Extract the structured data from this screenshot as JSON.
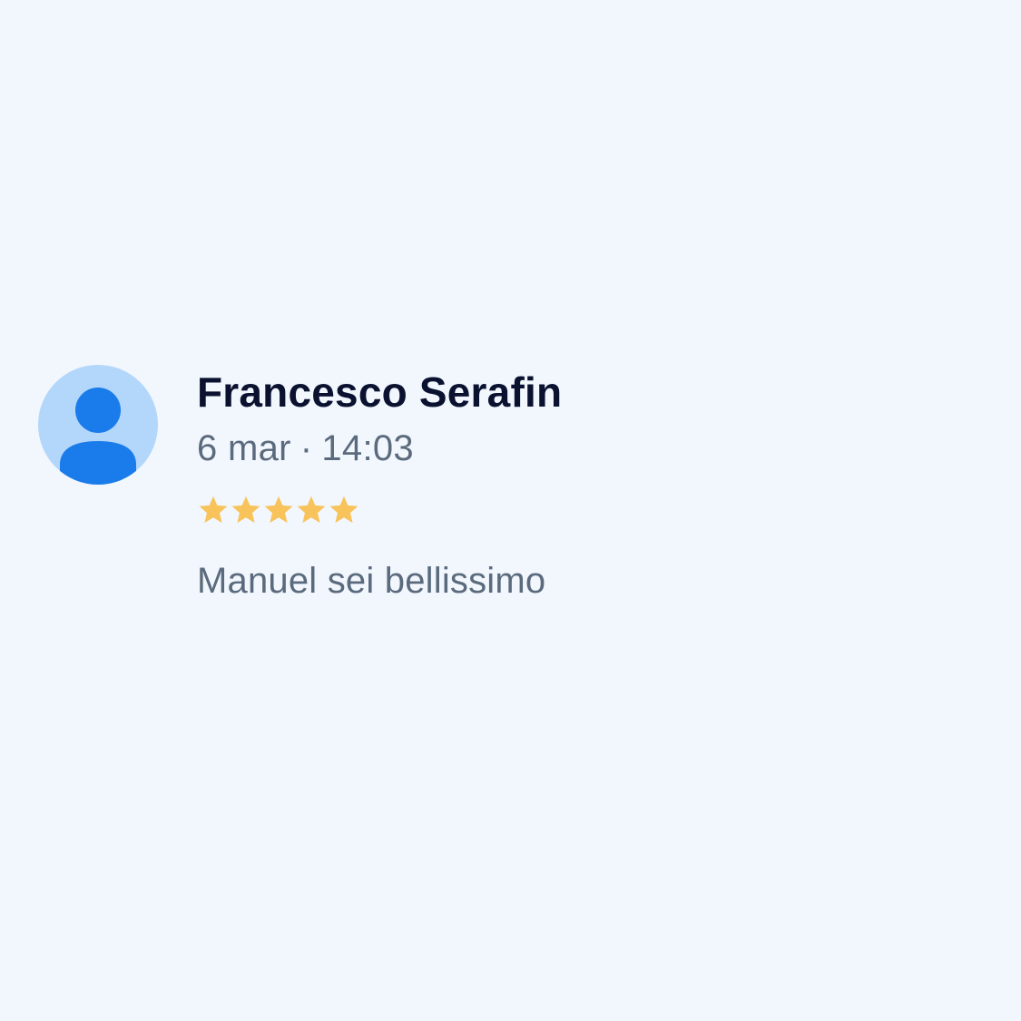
{
  "review": {
    "author": "Francesco Serafin",
    "date": "6 mar",
    "separator": "·",
    "time": "14:03",
    "rating": 5,
    "rating_max": 5,
    "text": "Manuel sei bellissimo"
  },
  "icons": {
    "avatar": "person-icon",
    "star": "star-icon"
  },
  "colors": {
    "background": "#f2f7fe",
    "avatar_bg": "#b3d6fb",
    "avatar_fg": "#1a7bea",
    "name": "#0b1230",
    "meta": "#5b6b7d",
    "star": "#f8c35b"
  }
}
